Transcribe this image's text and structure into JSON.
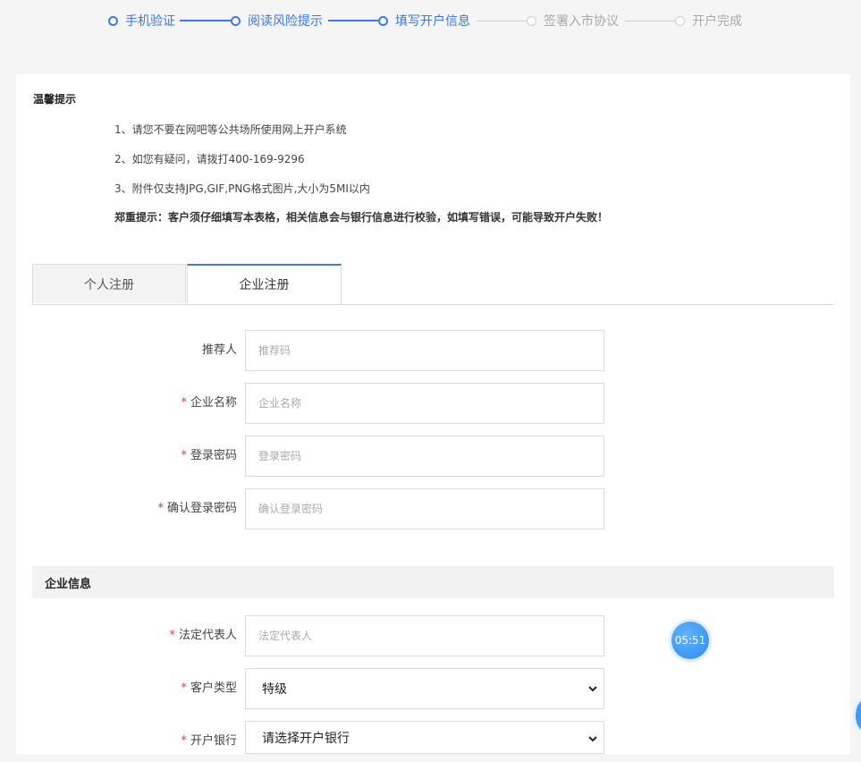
{
  "stepper": {
    "steps": [
      {
        "label": "手机验证",
        "state": "done"
      },
      {
        "label": "阅读风险提示",
        "state": "done"
      },
      {
        "label": "填写开户信息",
        "state": "current"
      },
      {
        "label": "签署入市协议",
        "state": "todo"
      },
      {
        "label": "开户完成",
        "state": "todo"
      }
    ]
  },
  "tips": {
    "title": "温馨提示",
    "items": [
      "1、请您不要在网吧等公共场所使用网上开户系统",
      "2、如您有疑问，请拨打400-169-9296",
      "3、附件仅支持JPG,GIF,PNG格式图片,大小为5MI以内"
    ],
    "warning": "郑重提示：客户须仔细填写本表格，相关信息会与银行信息进行校验，如填写错误，可能导致开户失败！"
  },
  "tabs": [
    {
      "label": "个人注册",
      "active": false
    },
    {
      "label": "企业注册",
      "active": true
    }
  ],
  "form": {
    "referrer": {
      "label": "推荐人",
      "placeholder": "推荐码",
      "required": false
    },
    "company_name": {
      "label": "企业名称",
      "placeholder": "企业名称",
      "required": true
    },
    "password": {
      "label": "登录密码",
      "placeholder": "登录密码",
      "required": true
    },
    "confirm_password": {
      "label": "确认登录密码",
      "placeholder": "确认登录密码",
      "required": true
    }
  },
  "company_info": {
    "section_title": "企业信息",
    "legal_rep": {
      "label": "法定代表人",
      "placeholder": "法定代表人",
      "required": true
    },
    "customer_type": {
      "label": "客户类型",
      "value": "特级",
      "required": true
    },
    "bank": {
      "label": "开户银行",
      "value": "请选择开户银行",
      "required": true
    }
  },
  "required_mark": "*",
  "timer": {
    "text": "05:51"
  },
  "colors": {
    "accent": "#3a77f0",
    "required": "#e23b3b"
  }
}
